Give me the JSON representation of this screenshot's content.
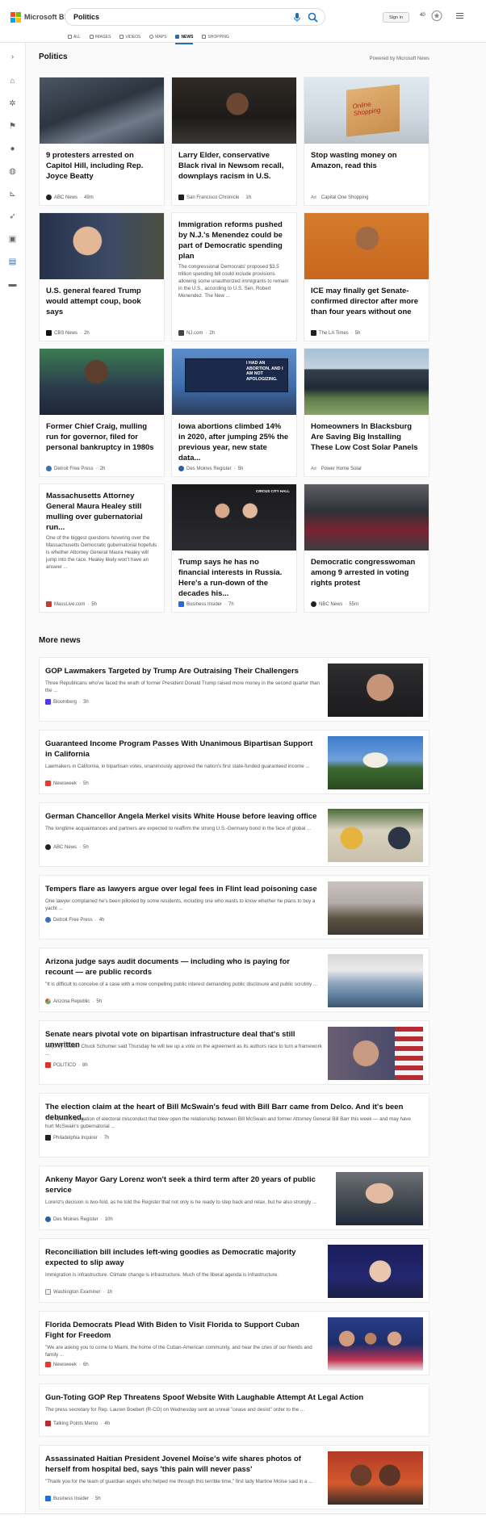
{
  "header": {
    "brand": "Microsoft Bing",
    "query": "Politics",
    "sign_in": "Sign in",
    "points": "40",
    "tabs": [
      {
        "label": "ALL"
      },
      {
        "label": "IMAGES"
      },
      {
        "label": "VIDEOS"
      },
      {
        "label": "MAPS"
      },
      {
        "label": "NEWS",
        "active": true
      },
      {
        "label": "SHOPPING"
      }
    ]
  },
  "colors": {
    "accent": "#1f6fb5",
    "brand_red": "#f25022",
    "brand_green": "#7fba00",
    "brand_blue": "#00a4ef",
    "brand_yellow": "#ffb900"
  },
  "main": {
    "section_title": "Politics",
    "powered_by": "Powered by Microsoft News",
    "more_title": "More news",
    "cards": [
      {
        "title": "9 protesters arrested on Capitol Hill, including Rep. Joyce Beatty",
        "source": "ABC News",
        "time": "49m",
        "icon": "abc-news-icon"
      },
      {
        "title": "Larry Elder, conservative Black rival in Newsom recall, downplays racism in U.S.",
        "source": "San Francisco Chronicle",
        "time": "1h",
        "icon": "sf-chronicle-icon"
      },
      {
        "title": "Stop wasting money on Amazon, read this",
        "ad": "Ad",
        "source": "Capital One Shopping",
        "time": "",
        "icon": "capital-one-icon",
        "image_text": "Online Shopping"
      },
      {
        "title": "U.S. general feared Trump would attempt coup, book says",
        "source": "CBS News",
        "time": "2h",
        "icon": "cbs-news-icon"
      },
      {
        "title": "Immigration reforms pushed by N.J.'s Menendez could be part of Democratic spending plan",
        "snippet": "The congressional Democrats' proposed $3.5 trillion spending bill could include provisions allowing some unauthorized immigrants to remain in the U.S., according to U.S. Sen. Robert Menendez. The New ...",
        "source": "NJ.com",
        "time": "2h",
        "icon": "nj-com-icon"
      },
      {
        "title": "ICE may finally get Senate-confirmed director after more than four years without one",
        "source": "The LA Times",
        "time": "5h",
        "icon": "la-times-icon"
      },
      {
        "title": "Former Chief Craig, mulling run for governor, filed for personal bankruptcy in 1980s",
        "source": "Detroit Free Press",
        "time": "2h",
        "icon": "detroit-free-press-icon"
      },
      {
        "title": "Iowa abortions climbed 14% in 2020, after jumping 25% the previous year, new state data...",
        "source": "Des Moines Register",
        "time": "5h",
        "icon": "des-moines-register-icon",
        "image_text": "I HAD AN ABORTION, AND I AM NOT APOLOGIZING."
      },
      {
        "title": "Homeowners In Blacksburg Are Saving Big Installing These Low Cost Solar Panels",
        "ad": "Ad",
        "source": "Power Home Solar",
        "time": "",
        "icon": "power-home-solar-icon"
      },
      {
        "title": "Massachusetts Attorney General Maura Healey still mulling over gubernatorial run...",
        "snippet": "One of the biggest questions hovering over the Massachusetts Democratic gubernatorial hopefuls is whether Attorney General Maura Healey will jump into the race. Healey likely won't have an answer ...",
        "source": "MassLive.com",
        "time": "5h",
        "icon": "masslive-icon"
      },
      {
        "title": "Trump says he has no financial interests in Russia. Here's a run-down of the decades his...",
        "source": "Business Insider",
        "time": "7h",
        "icon": "business-insider-icon",
        "image_text": "CIRCUS CITY HALL"
      },
      {
        "title": "Democratic congresswoman among 9 arrested in voting rights protest",
        "source": "NBC News",
        "time": "55m",
        "icon": "nbc-news-icon"
      }
    ],
    "more": [
      {
        "title": "GOP Lawmakers Targeted by Trump Are Outraising Their Challengers",
        "snippet": "Three Republicans who've faced the wrath of former President Donald Trump raised more money in the second quarter than the ...",
        "source": "Bloomberg",
        "time": "3h"
      },
      {
        "title": "Guaranteed Income Program Passes With Unanimous Bipartisan Support in California",
        "snippet": "Lawmakers in California, in bipartisan votes, unanimously approved the nation's first state-funded guaranteed income ...",
        "source": "Newsweek",
        "time": "5h"
      },
      {
        "title": "German Chancellor Angela Merkel visits White House before leaving office",
        "snippet": "The longtime acquaintances and partners are expected to reaffirm the strong U.S.-Germany bond in the face of global ...",
        "source": "ABC News",
        "time": "5h"
      },
      {
        "title": "Tempers flare as lawyers argue over legal fees in Flint lead poisoning case",
        "snippet": "One lawyer complained he's been pilloried by some residents, including one who wants to know whether he plans to buy a yacht ...",
        "source": "Detroit Free Press",
        "time": "4h"
      },
      {
        "title": "Arizona judge says audit documents — including who is paying for recount — are public records",
        "snippet": "\"It is difficult to conceive of a case with a more compelling public interest demanding public disclosure and public scrutiny ...",
        "source": "Arizona Republic",
        "time": "5h"
      },
      {
        "title": "Senate nears pivotal vote on bipartisan infrastructure deal that's still unwritten",
        "snippet": "Majority Leader Chuck Schumer said Thursday he will tee up a vote on the agreement as its authors race to turn a framework ...",
        "source": "POLITICO",
        "time": "8h"
      },
      {
        "title": "The election claim at the heart of Bill McSwain's feud with Bill Barr came from Delco. And it's been debunked.",
        "snippet": "The specific allegation of electoral misconduct that blew open the relationship between Bill McSwain and former Attorney General Bill Barr this week — and may have hurt McSwain's gubernatorial ...",
        "source": "Philadelphia Inquirer",
        "time": "7h"
      },
      {
        "title": "Ankeny Mayor Gary Lorenz won't seek a third term after 20 years of public service",
        "snippet": "Lorenz's decision is two-fold, as he told the Register that not only is he ready to step back and relax, but he also strongly ...",
        "source": "Des Moines Register",
        "time": "10h"
      },
      {
        "title": "Reconciliation bill includes left-wing goodies as Democratic majority expected to slip away",
        "snippet": "Immigration is infrastructure. Climate change is infrastructure. Much of the liberal agenda is infrastructure.",
        "source": "Washington Examiner",
        "time": "1h"
      },
      {
        "title": "Florida Democrats Plead With Biden to Visit Florida to Support Cuban Fight for Freedom",
        "snippet": "\"We are asking you to come to Miami, the home of the Cuban-American community, and hear the cries of our friends and family ...",
        "source": "Newsweek",
        "time": "6h"
      },
      {
        "title": "Gun-Toting GOP Rep Threatens Spoof Website With Laughable Attempt At Legal Action",
        "snippet": "The press secretary for Rep. Lauren Boebert (R-CO) on Wednesday sent an unreal \"cease and desist\" order to the ...",
        "source": "Talking Points Memo",
        "time": "4h"
      },
      {
        "title": "Assassinated Haitian President Jovenel Moïse's wife shares photos of herself from hospital bed, says 'this pain will never pass'",
        "snippet": "\"Thank you for the team of guardian angels who helped me through this terrible time,\" first lady Martine Moïse said in a ...",
        "source": "Business Insider",
        "time": "5h"
      }
    ]
  }
}
